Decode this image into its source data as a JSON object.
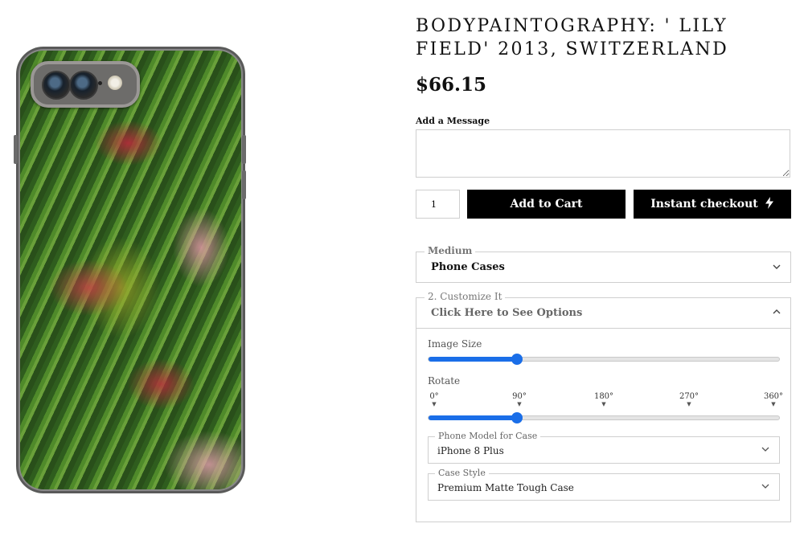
{
  "product": {
    "title": "BODYPAINTOGRAPHY: ' LILY FIELD' 2013, SWITZERLAND",
    "price": "$66.15"
  },
  "message": {
    "label": "Add a Message",
    "value": ""
  },
  "cart": {
    "quantity": "1",
    "add_to_cart_label": "Add to Cart",
    "instant_checkout_label": "Instant checkout",
    "instant_checkout_icon": "lightning-bolt-icon"
  },
  "medium": {
    "legend": "Medium",
    "selected": "Phone Cases"
  },
  "customize": {
    "legend": "2. Customize It",
    "toggle_label": "Click Here to See Options",
    "image_size": {
      "label": "Image Size",
      "value_fraction": 0.25
    },
    "rotate": {
      "label": "Rotate",
      "ticks": [
        "0°",
        "90°",
        "180°",
        "270°",
        "360°"
      ],
      "value_degrees": 90
    },
    "phone_model": {
      "legend": "Phone Model for Case",
      "selected": "iPhone 8 Plus"
    },
    "case_style": {
      "legend": "Case Style",
      "selected": "Premium Matte Tough Case"
    }
  },
  "colors": {
    "button_bg": "#000000",
    "slider_accent": "#1a6ee8",
    "border": "#cfcfcf"
  }
}
